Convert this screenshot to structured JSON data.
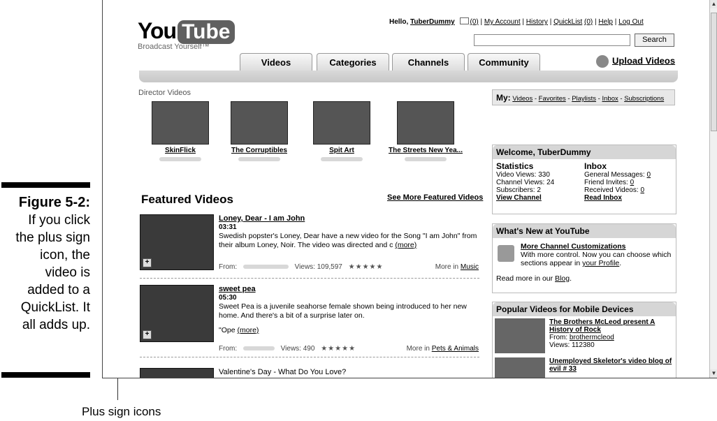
{
  "caption": {
    "figure": "Figure 5-2:",
    "lines": [
      "If you click",
      "the plus sign",
      "icon, the",
      "video is",
      "added to a",
      "QuickList. It",
      "all adds up."
    ],
    "callout": "Plus sign icons"
  },
  "logo": {
    "you": "You",
    "tube": "Tube",
    "tagline": "Broadcast Yourself™"
  },
  "header": {
    "hello": "Hello,",
    "user": "TuberDummy",
    "inbox_count": "(0)",
    "sep": "|",
    "my_account": "My Account",
    "history": "History",
    "quicklist": "QuickList",
    "quicklist_count": "(0)",
    "help": "Help",
    "logout": "Log Out"
  },
  "search": {
    "value": "",
    "button": "Search"
  },
  "tabs": [
    "Videos",
    "Categories",
    "Channels",
    "Community"
  ],
  "upload": "Upload Videos",
  "director": {
    "label": "Director Videos",
    "items": [
      {
        "title": "SkinFlick"
      },
      {
        "title": "The Corruptibles"
      },
      {
        "title": "Spit Art"
      },
      {
        "title": "The Streets New Yea..."
      }
    ]
  },
  "featured": {
    "title": "Featured Videos",
    "see_more": "See More Featured Videos",
    "videos": [
      {
        "title": "Loney, Dear - I am John",
        "duration": "03:31",
        "desc": "Swedish popster's Loney, Dear have a new video for the Song \"I am John\" from their album Loney, Noir. The video was directed and c",
        "more": "(more)",
        "from": "From:",
        "views": "Views: 109,597",
        "stars": "★★★★★",
        "more_in": "More in",
        "category": "Music"
      },
      {
        "title": "sweet pea",
        "duration": "05:30",
        "desc": "Sweet Pea is a juvenile seahorse female shown being introduced to her new home. And there's a bit of a surprise later on.",
        "quote": "\"Ope",
        "more": "(more)",
        "from": "From:",
        "views": "Views: 490",
        "stars": "★★★★★",
        "more_in": "More in",
        "category": "Pets & Animals"
      },
      {
        "title": "Valentine's Day - What Do You Love?"
      }
    ]
  },
  "my_bar": {
    "label": "My:",
    "links": [
      "Videos",
      "Favorites",
      "Playlists",
      "Inbox",
      "Subscriptions"
    ],
    "sep": " - "
  },
  "welcome": {
    "title": "Welcome, TuberDummy",
    "stats_head": "Statistics",
    "stats": [
      "Video Views: 330",
      "Channel Views: 24",
      "Subscribers: 2"
    ],
    "view_channel": "View Channel",
    "inbox_head": "Inbox",
    "inbox": [
      {
        "label": "General Messages:",
        "val": "0"
      },
      {
        "label": "Friend Invites:",
        "val": "0"
      },
      {
        "label": "Received Videos:",
        "val": "0"
      }
    ],
    "read_inbox": "Read Inbox"
  },
  "whats_new": {
    "title": "What's New at YouTube",
    "item_title": "More Channel Customizations",
    "item_text": "With more control. Now you can choose which sections appear in",
    "item_link": "your Profile",
    "footer": "Read more in our",
    "footer_link": "Blog"
  },
  "popular": {
    "title": "Popular Videos for Mobile Devices",
    "items": [
      {
        "title": "The Brothers McLeod present A History of Rock",
        "from": "From:",
        "from_user": "brothermcleod",
        "views": "Views: 112380"
      },
      {
        "title": "Unemployed Skeletor's video blog of evil # 33"
      }
    ]
  }
}
